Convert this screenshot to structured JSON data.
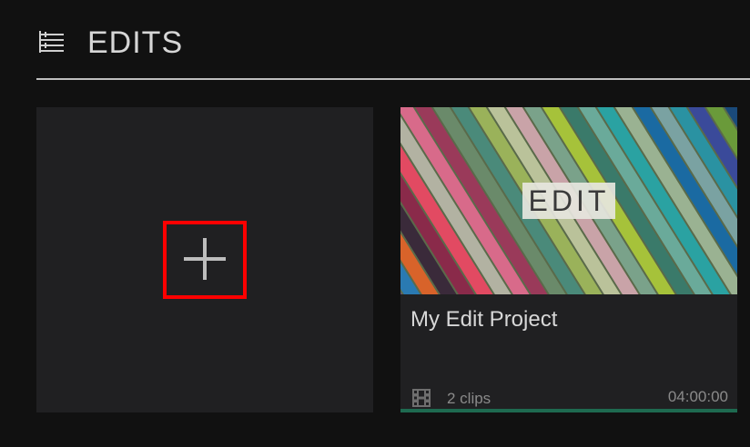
{
  "header": {
    "title": "EDITS",
    "icon": "edits-list-icon"
  },
  "new_edit": {
    "icon": "plus-icon"
  },
  "project": {
    "thumbnail_text": "EDIT",
    "title": "My Edit Project",
    "clips_icon": "film-strip-icon",
    "clips": "2 clips",
    "duration": "04:00:00"
  },
  "colors": {
    "background": "#111111",
    "tile": "#202022",
    "highlight_border": "#ff0000",
    "progress_bar": "#1e6a50"
  }
}
